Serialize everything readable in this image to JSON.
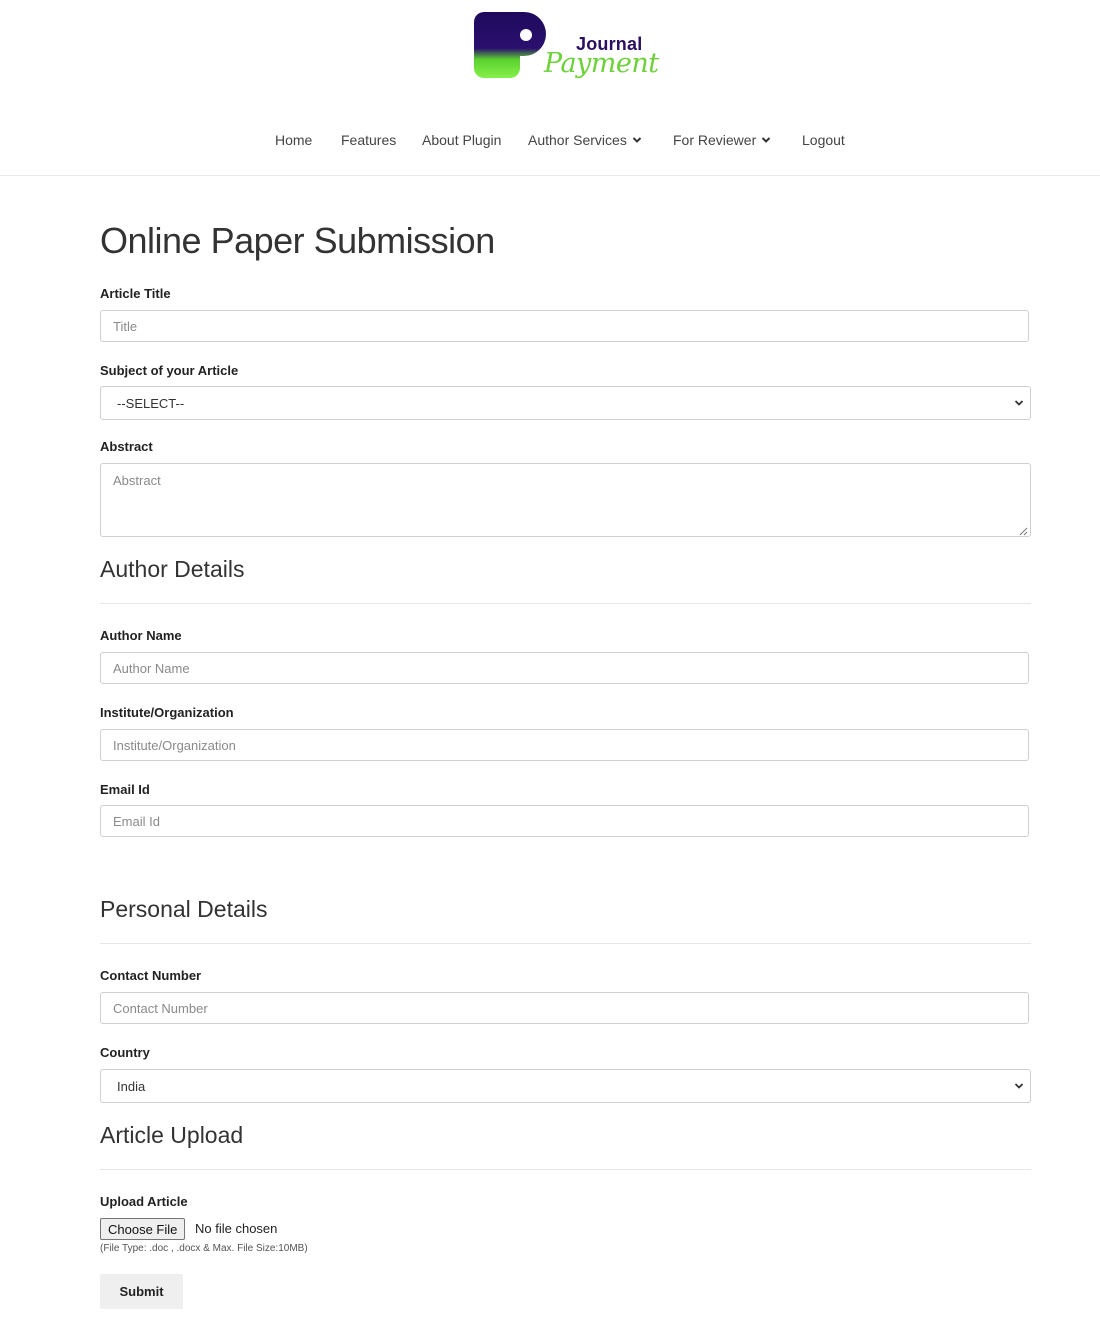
{
  "brand": {
    "line1": "Journal",
    "line2": "Payment",
    "icon": "journal-payment-logo",
    "colors": {
      "dark": "#1e0a5c",
      "green": "#6dd13a"
    }
  },
  "nav": {
    "items": [
      {
        "label": "Home"
      },
      {
        "label": "Features"
      },
      {
        "label": "About Plugin"
      },
      {
        "label": "Author Services",
        "icon": "chevron-down-icon"
      },
      {
        "label": "For Reviewer",
        "icon": "chevron-down-icon"
      },
      {
        "label": "Logout"
      }
    ]
  },
  "form": {
    "title": "Online Paper Submission",
    "article_title": {
      "label": "Article Title",
      "placeholder": "Title"
    },
    "subject": {
      "label": "Subject of your Article",
      "value": "--SELECT--"
    },
    "abstract": {
      "label": "Abstract",
      "placeholder": "Abstract"
    },
    "author_section": "Author Details",
    "author_name": {
      "label": "Author Name",
      "placeholder": "Author Name"
    },
    "institute": {
      "label": "Institute/Organization",
      "placeholder": "Institute/Organization"
    },
    "email": {
      "label": "Email Id",
      "placeholder": "Email Id"
    },
    "personal_section": "Personal Details",
    "contact": {
      "label": "Contact Number",
      "placeholder": "Contact Number"
    },
    "country": {
      "label": "Country",
      "value": "India"
    },
    "upload_section": "Article Upload",
    "upload": {
      "label": "Upload Article",
      "button": "Choose File",
      "status": "No file chosen",
      "hint": "(File Type: .doc , .docx & Max. File Size:10MB)"
    },
    "submit": "Submit"
  }
}
